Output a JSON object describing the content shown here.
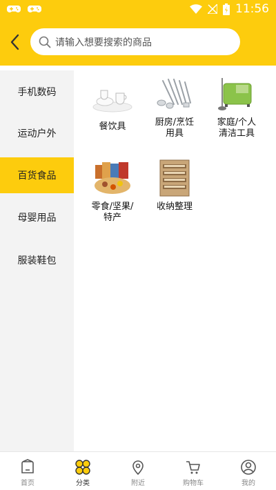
{
  "status_bar": {
    "time": "11:56"
  },
  "search": {
    "placeholder": "请输入想要搜索的商品"
  },
  "sidebar": {
    "items": [
      {
        "label": "手机数码"
      },
      {
        "label": "运动户外"
      },
      {
        "label": "百货食品",
        "active": true
      },
      {
        "label": "母婴用品"
      },
      {
        "label": "服装鞋包"
      }
    ]
  },
  "categories": [
    {
      "label": "餐饮具"
    },
    {
      "label": "厨房/烹饪\n用具"
    },
    {
      "label": "家庭/个人\n清洁工具"
    },
    {
      "label": "零食/坚果/\n特产"
    },
    {
      "label": "收纳整理"
    }
  ],
  "bottom_nav": {
    "items": [
      {
        "label": "首页",
        "icon": "home-icon"
      },
      {
        "label": "分类",
        "icon": "category-icon",
        "active": true
      },
      {
        "label": "附近",
        "icon": "location-icon"
      },
      {
        "label": "购物车",
        "icon": "cart-icon"
      },
      {
        "label": "我的",
        "icon": "profile-icon"
      }
    ]
  },
  "colors": {
    "accent": "#FDCC0D",
    "sidebar_bg": "#F3F3F3"
  }
}
